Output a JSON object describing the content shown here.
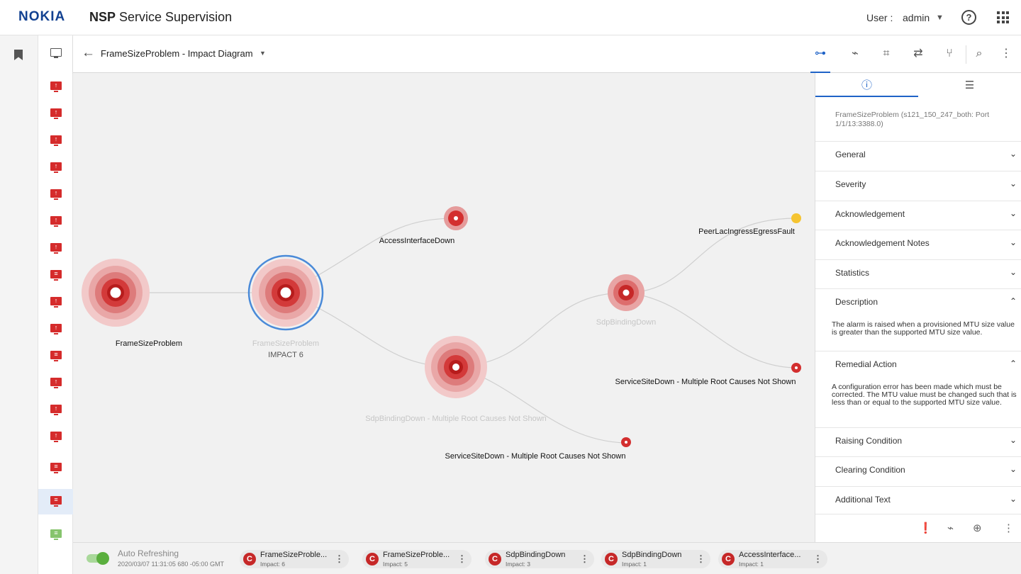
{
  "header": {
    "logo": "NOKIA",
    "app_title_bold": "NSP",
    "app_title_rest": " Service Supervision",
    "user_label": "User :",
    "user_name": "admin"
  },
  "toolbar": {
    "title": "FrameSizeProblem - Impact Diagram"
  },
  "diagram": {
    "nodes": [
      {
        "label": "FrameSizeProblem",
        "dimmed": false
      },
      {
        "label": "FrameSizeProblem",
        "dimmed": true,
        "sub": "IMPACT 6"
      },
      {
        "label": "AccessInterfaceDown",
        "dimmed": false
      },
      {
        "label": "SdpBindingDown - Multiple Root Causes Not Shown",
        "dimmed": true
      },
      {
        "label": "SdpBindingDown",
        "dimmed": true
      },
      {
        "label": "ServiceSiteDown - Multiple Root Causes Not Shown",
        "dimmed": false
      },
      {
        "label": "PeerLacIngressEgressFault",
        "dimmed": false
      },
      {
        "label": "ServiceSiteDown - Multiple Root Causes Not Shown",
        "dimmed": false
      }
    ]
  },
  "panel": {
    "subtitle": "FrameSizeProblem (s121_150_247_both: Port 1/1/13:3388.0)",
    "sections": [
      {
        "label": "General"
      },
      {
        "label": "Severity"
      },
      {
        "label": "Acknowledgement"
      },
      {
        "label": "Acknowledgement Notes"
      },
      {
        "label": "Statistics"
      },
      {
        "label": "Description",
        "body": "The alarm is raised when a provisioned MTU size value is greater than the supported MTU size value."
      },
      {
        "label": "Remedial Action",
        "body": "A configuration error has been made which must be corrected.  The MTU value must be changed such that is  less than or equal to the supported MTU size value."
      },
      {
        "label": "Raising Condition"
      },
      {
        "label": "Clearing Condition"
      },
      {
        "label": "Additional Text"
      }
    ]
  },
  "statusbar": {
    "auto_refresh_label": "Auto Refreshing",
    "timestamp": "2020/03/07 11:31:05 680 -05:00 GMT",
    "chips": [
      {
        "badge": "C",
        "name": "FrameSizeProble...",
        "impact": "Impact: 6"
      },
      {
        "badge": "C",
        "name": "FrameSizeProble...",
        "impact": "Impact: 5"
      },
      {
        "badge": "C",
        "name": "SdpBindingDown",
        "impact": "Impact: 3"
      },
      {
        "badge": "C",
        "name": "SdpBindingDown",
        "impact": "Impact: 1"
      },
      {
        "badge": "C",
        "name": "AccessInterface...",
        "impact": "Impact: 1"
      }
    ]
  },
  "colors": {
    "accent": "#1f63c7",
    "critical": "#c62828",
    "warning": "#f5c431",
    "brand": "#124191"
  },
  "icons": {
    "alarm_list": [
      "monitor-icon",
      "alarm-up-icon",
      "alarm-up-icon",
      "alarm-up-icon",
      "alarm-up-icon",
      "alarm-up-icon",
      "alarm-up-icon",
      "alarm-up-icon",
      "alarm-list-icon",
      "alarm-up-icon",
      "alarm-up-icon",
      "alarm-list-icon",
      "alarm-up-icon",
      "alarm-up-icon",
      "alarm-up-icon",
      "alarm-list-icon",
      "alarm-list-icon",
      "alarm-list-cleared-icon"
    ]
  }
}
